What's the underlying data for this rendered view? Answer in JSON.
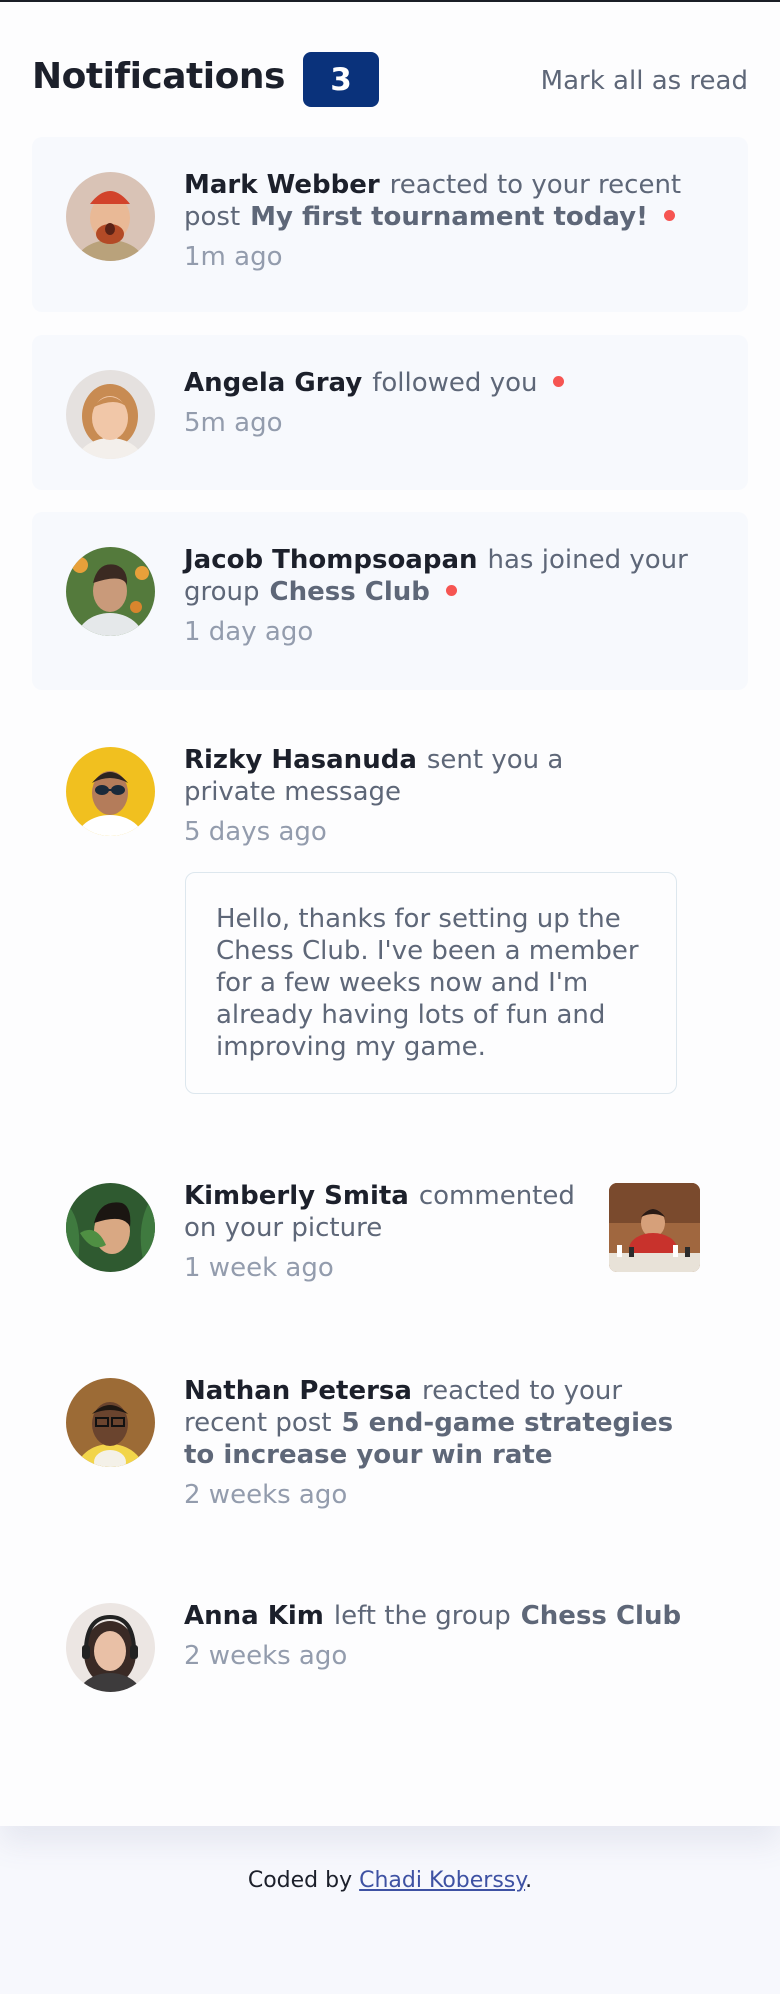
{
  "header": {
    "title": "Notifications",
    "unread_count": "3",
    "mark_all_label": "Mark all as read"
  },
  "notifications": [
    {
      "name": "Mark Webber",
      "action": "reacted to your recent post",
      "subject": "My first tournament today!",
      "time": "1m ago",
      "unread": true,
      "avatar": {
        "bg": "#d9c3b6",
        "hair": "#b34a26",
        "skin": "#e9b996",
        "shirt": "#b9a27b",
        "hat": "#d2432b"
      }
    },
    {
      "name": "Angela Gray",
      "action": "followed you",
      "time": "5m ago",
      "unread": true,
      "avatar": {
        "bg": "#e5e1df",
        "hair": "#c88b52",
        "skin": "#f1c7a8",
        "shirt": "#f3efeb"
      }
    },
    {
      "name": "Jacob Thompsoapan",
      "action": "has joined your group",
      "subject": "Chess Club",
      "time": "1 day ago",
      "unread": true,
      "avatar": {
        "bg": "#547a3c",
        "hair": "#3b2a22",
        "skin": "#c99a7a",
        "shirt": "#e5e8ea"
      }
    },
    {
      "name": "Rizky Hasanuda",
      "action": "sent you a private message",
      "time": "5 days ago",
      "unread": false,
      "message": "Hello, thanks for setting up the Chess Club. I've been a member for a few weeks now and I'm already having lots of fun and improving my game.",
      "avatar": {
        "bg": "#f1c01f",
        "hair": "#2c2420",
        "skin": "#b47c5a",
        "shirt": "#ffffff"
      }
    },
    {
      "name": "Kimberly Smita",
      "action": "commented on your picture",
      "time": "1 week ago",
      "unread": false,
      "avatar": {
        "bg": "#2f5a30",
        "hair": "#1b1612",
        "skin": "#d9a883",
        "shirt": "#2f5a30"
      }
    },
    {
      "name": "Nathan Petersa",
      "action": "reacted to your recent post",
      "subject": "5 end-game strategies to increase your win rate",
      "time": "2 weeks ago",
      "unread": false,
      "avatar": {
        "bg": "#9c6b36",
        "hair": "#1e1712",
        "skin": "#6a442e",
        "shirt": "#f2d54a"
      }
    },
    {
      "name": "Anna Kim",
      "action": "left the group",
      "subject": "Chess Club",
      "time": "2 weeks ago",
      "unread": false,
      "avatar": {
        "bg": "#ece6e3",
        "hair": "#3a2a25",
        "skin": "#e9c0a6",
        "shirt": "#3d3b3c"
      }
    }
  ],
  "footer": {
    "prefix": "Coded by ",
    "author": "Chadi Koberssy",
    "suffix": "."
  },
  "colors": {
    "accent": "#0a327b",
    "unread_dot": "#f65552",
    "unread_bg": "#f7f9fd",
    "heading": "#1c202b",
    "body_text": "#5e6778",
    "muted_text": "#939cad"
  }
}
